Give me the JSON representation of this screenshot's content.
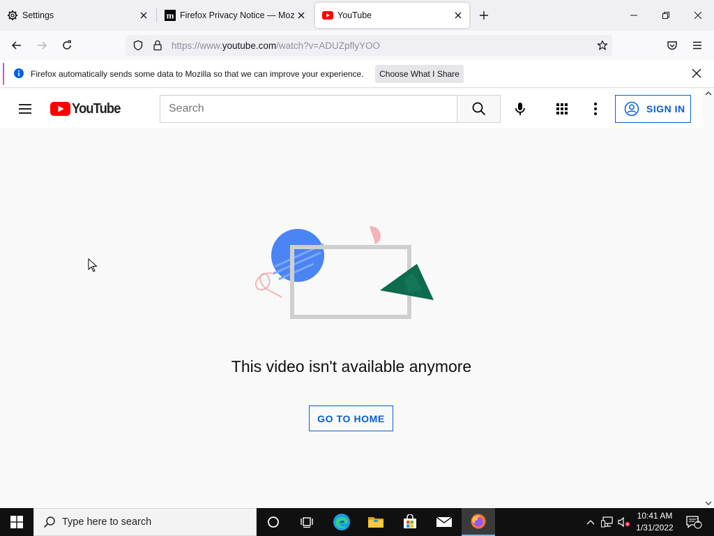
{
  "browser": {
    "tabs": [
      {
        "title": "Settings",
        "icon": "gear-icon",
        "active": false
      },
      {
        "title": "Firefox Privacy Notice — Mozilla",
        "icon": "mozilla-m-icon",
        "active": false
      },
      {
        "title": "YouTube",
        "icon": "youtube-icon",
        "active": true
      }
    ],
    "url": {
      "prefix": "https://www.",
      "domain": "youtube.com",
      "path": "/watch?v=ADUZpflyYOO"
    },
    "notification": {
      "message": "Firefox automatically sends some data to Mozilla so that we can improve your experience.",
      "button": "Choose What I Share"
    }
  },
  "youtube": {
    "logo_text": "YouTube",
    "search_placeholder": "Search",
    "sign_in": "SIGN IN",
    "error_message": "This video isn't available anymore",
    "go_home": "GO TO HOME"
  },
  "taskbar": {
    "search_placeholder": "Type here to search",
    "time": "10:41 AM",
    "date": "1/31/2022",
    "notification_count": "1"
  },
  "colors": {
    "youtube_red": "#ff0000",
    "youtube_blue": "#065fd4",
    "taskbar": "#101010"
  }
}
